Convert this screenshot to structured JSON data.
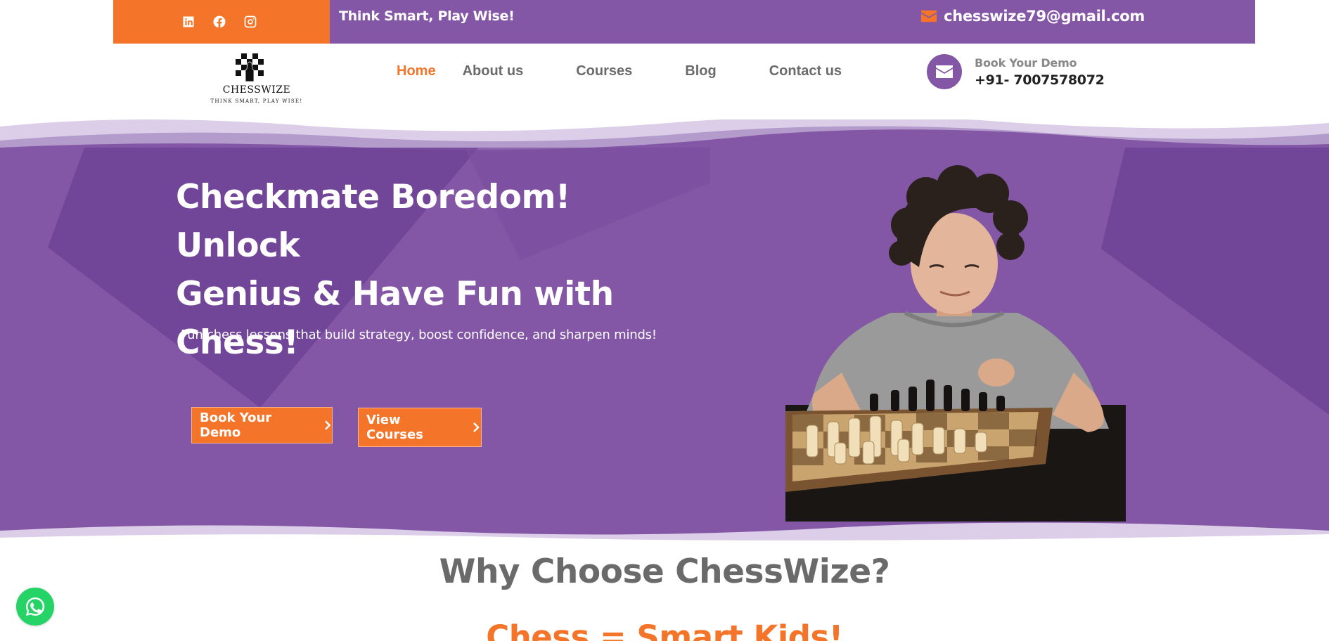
{
  "topbar": {
    "social": [
      {
        "name": "linkedin-icon"
      },
      {
        "name": "facebook-icon"
      },
      {
        "name": "instagram-icon"
      }
    ],
    "tagline": "Think Smart, Play Wise!",
    "email": "chesswize79@gmail.com"
  },
  "logo": {
    "name": "CHESSWIZE",
    "tagline": "THINK SMART, PLAY WISE!"
  },
  "nav": {
    "items": [
      {
        "label": "Home",
        "active": true
      },
      {
        "label": "About us",
        "active": false
      },
      {
        "label": "Courses",
        "active": false
      },
      {
        "label": "Blog",
        "active": false
      },
      {
        "label": "Contact us",
        "active": false
      }
    ]
  },
  "demo": {
    "label": "Book Your Demo",
    "phone": "+91- 7007578072"
  },
  "hero": {
    "title_line1": "Checkmate Boredom! Unlock",
    "title_line2": "Genius & Have Fun with",
    "title_line3": "Chess!",
    "subtitle": "Fun chess lessons that build strategy, boost confidence, and sharpen minds!",
    "btn_demo": "Book Your Demo",
    "btn_courses": "View Courses"
  },
  "section": {
    "why_title": "Why Choose ChessWize?",
    "smart_title": "Chess = Smart Kids!"
  },
  "colors": {
    "orange": "#F47529",
    "purple": "#8357A6",
    "purple_dark": "#6E4295",
    "whatsapp": "#25D366"
  }
}
